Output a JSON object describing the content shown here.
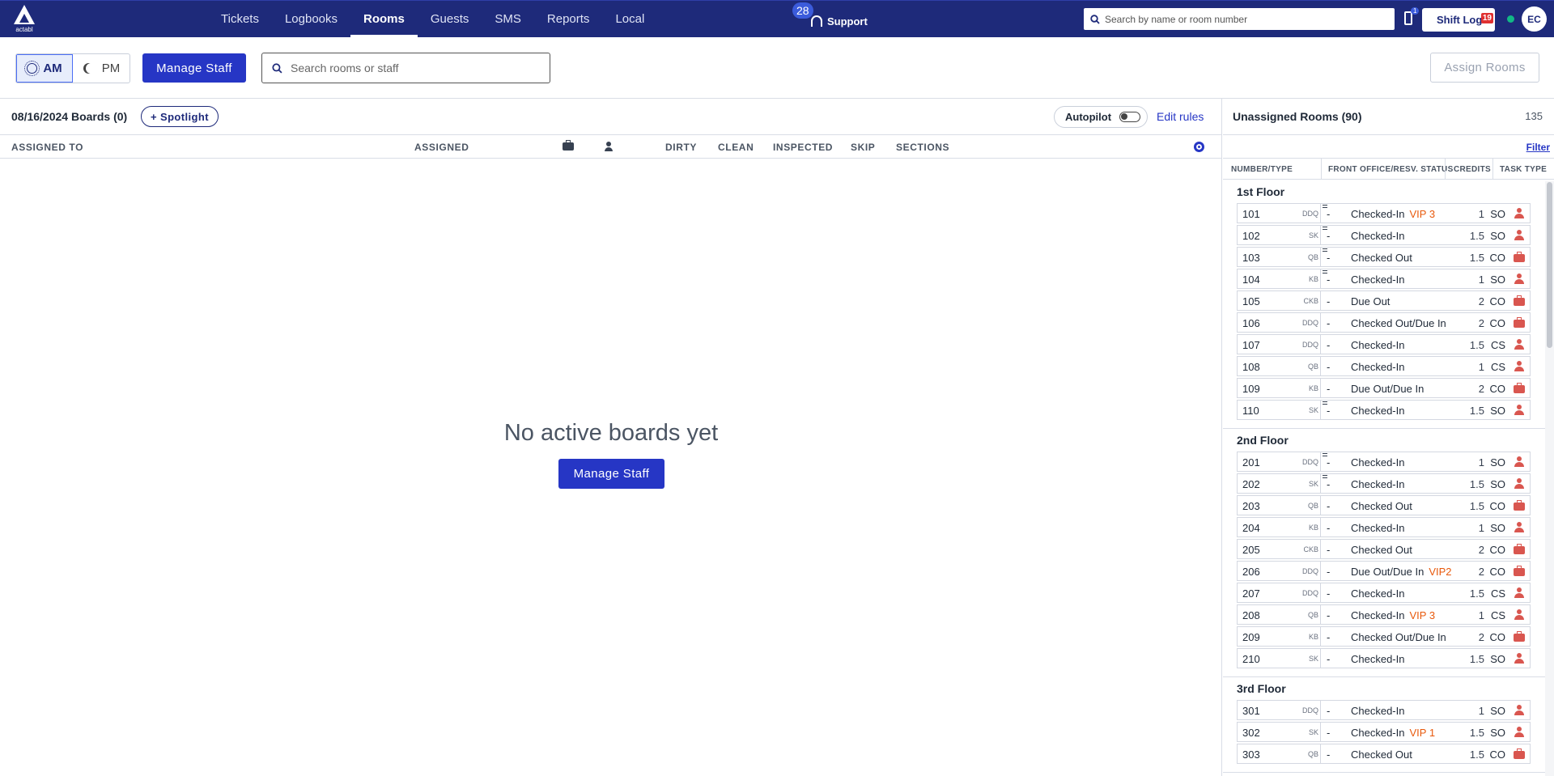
{
  "nav": {
    "logo_text": "actabl",
    "links": [
      "Tickets",
      "Logbooks",
      "Rooms",
      "Guests",
      "SMS",
      "Reports",
      "Local"
    ],
    "active": "Rooms",
    "support_badge": "28",
    "support_label": "Support",
    "search_placeholder": "Search by name or room number",
    "phone_badge": "1",
    "shift_log_label": "Shift Log",
    "shift_log_count": "19",
    "avatar_initials": "EC"
  },
  "toolbar": {
    "am_label": "AM",
    "pm_label": "PM",
    "manage_staff_label": "Manage Staff",
    "search_placeholder": "Search rooms or staff",
    "assign_rooms_label": "Assign Rooms"
  },
  "boards": {
    "title": "08/16/2024 Boards (0)",
    "spotlight_label": "+ Spotlight",
    "autopilot_label": "Autopilot",
    "edit_rules_label": "Edit rules",
    "columns": {
      "assigned_to": "ASSIGNED TO",
      "assigned": "ASSIGNED",
      "dirty": "DIRTY",
      "clean": "CLEAN",
      "inspected": "INSPECTED",
      "skip": "SKIP",
      "sections": "SECTIONS"
    },
    "empty_title": "No active boards yet",
    "empty_button": "Manage Staff"
  },
  "unassigned": {
    "title": "Unassigned Rooms (90)",
    "count": "135",
    "filter_label": "Filter",
    "columns": {
      "number_type": "NUMBER/TYPE",
      "status": "FRONT OFFICE/RESV. STATUS",
      "credits": "CREDITS",
      "task_type": "TASK TYPE"
    },
    "floors": [
      {
        "name": "1st Floor",
        "rooms": [
          {
            "num": "101",
            "type": "DDQ",
            "note": true,
            "status": "Checked-In",
            "vip": "VIP 3",
            "credits": "1",
            "task": "SO",
            "icon": "person"
          },
          {
            "num": "102",
            "type": "SK",
            "note": true,
            "status": "Checked-In",
            "vip": "",
            "credits": "1.5",
            "task": "SO",
            "icon": "person"
          },
          {
            "num": "103",
            "type": "QB",
            "note": true,
            "status": "Checked Out",
            "vip": "",
            "credits": "1.5",
            "task": "CO",
            "icon": "case"
          },
          {
            "num": "104",
            "type": "KB",
            "note": true,
            "status": "Checked-In",
            "vip": "",
            "credits": "1",
            "task": "SO",
            "icon": "person"
          },
          {
            "num": "105",
            "type": "CKB",
            "note": false,
            "status": "Due Out",
            "vip": "",
            "credits": "2",
            "task": "CO",
            "icon": "case"
          },
          {
            "num": "106",
            "type": "DDQ",
            "note": false,
            "status": "Checked Out/Due In",
            "vip": "",
            "credits": "2",
            "task": "CO",
            "icon": "case"
          },
          {
            "num": "107",
            "type": "DDQ",
            "note": false,
            "status": "Checked-In",
            "vip": "",
            "credits": "1.5",
            "task": "CS",
            "icon": "person"
          },
          {
            "num": "108",
            "type": "QB",
            "note": false,
            "status": "Checked-In",
            "vip": "",
            "credits": "1",
            "task": "CS",
            "icon": "person"
          },
          {
            "num": "109",
            "type": "KB",
            "note": false,
            "status": "Due Out/Due In",
            "vip": "",
            "credits": "2",
            "task": "CO",
            "icon": "case"
          },
          {
            "num": "110",
            "type": "SK",
            "note": true,
            "status": "Checked-In",
            "vip": "",
            "credits": "1.5",
            "task": "SO",
            "icon": "person"
          }
        ]
      },
      {
        "name": "2nd Floor",
        "rooms": [
          {
            "num": "201",
            "type": "DDQ",
            "note": true,
            "status": "Checked-In",
            "vip": "",
            "credits": "1",
            "task": "SO",
            "icon": "person"
          },
          {
            "num": "202",
            "type": "SK",
            "note": true,
            "status": "Checked-In",
            "vip": "",
            "credits": "1.5",
            "task": "SO",
            "icon": "person"
          },
          {
            "num": "203",
            "type": "QB",
            "note": false,
            "status": "Checked Out",
            "vip": "",
            "credits": "1.5",
            "task": "CO",
            "icon": "case"
          },
          {
            "num": "204",
            "type": "KB",
            "note": false,
            "status": "Checked-In",
            "vip": "",
            "credits": "1",
            "task": "SO",
            "icon": "person"
          },
          {
            "num": "205",
            "type": "CKB",
            "note": false,
            "status": "Checked Out",
            "vip": "",
            "credits": "2",
            "task": "CO",
            "icon": "case"
          },
          {
            "num": "206",
            "type": "DDQ",
            "note": false,
            "status": "Due Out/Due In",
            "vip": "VIP2",
            "credits": "2",
            "task": "CO",
            "icon": "case"
          },
          {
            "num": "207",
            "type": "DDQ",
            "note": false,
            "status": "Checked-In",
            "vip": "",
            "credits": "1.5",
            "task": "CS",
            "icon": "person"
          },
          {
            "num": "208",
            "type": "QB",
            "note": false,
            "status": "Checked-In",
            "vip": "VIP 3",
            "credits": "1",
            "task": "CS",
            "icon": "person"
          },
          {
            "num": "209",
            "type": "KB",
            "note": false,
            "status": "Checked Out/Due In",
            "vip": "",
            "credits": "2",
            "task": "CO",
            "icon": "case"
          },
          {
            "num": "210",
            "type": "SK",
            "note": false,
            "status": "Checked-In",
            "vip": "",
            "credits": "1.5",
            "task": "SO",
            "icon": "person"
          }
        ]
      },
      {
        "name": "3rd Floor",
        "rooms": [
          {
            "num": "301",
            "type": "DDQ",
            "note": false,
            "status": "Checked-In",
            "vip": "",
            "credits": "1",
            "task": "SO",
            "icon": "person"
          },
          {
            "num": "302",
            "type": "SK",
            "note": false,
            "status": "Checked-In",
            "vip": "VIP 1",
            "credits": "1.5",
            "task": "SO",
            "icon": "person"
          },
          {
            "num": "303",
            "type": "QB",
            "note": false,
            "status": "Checked Out",
            "vip": "",
            "credits": "1.5",
            "task": "CO",
            "icon": "case"
          }
        ]
      }
    ]
  }
}
